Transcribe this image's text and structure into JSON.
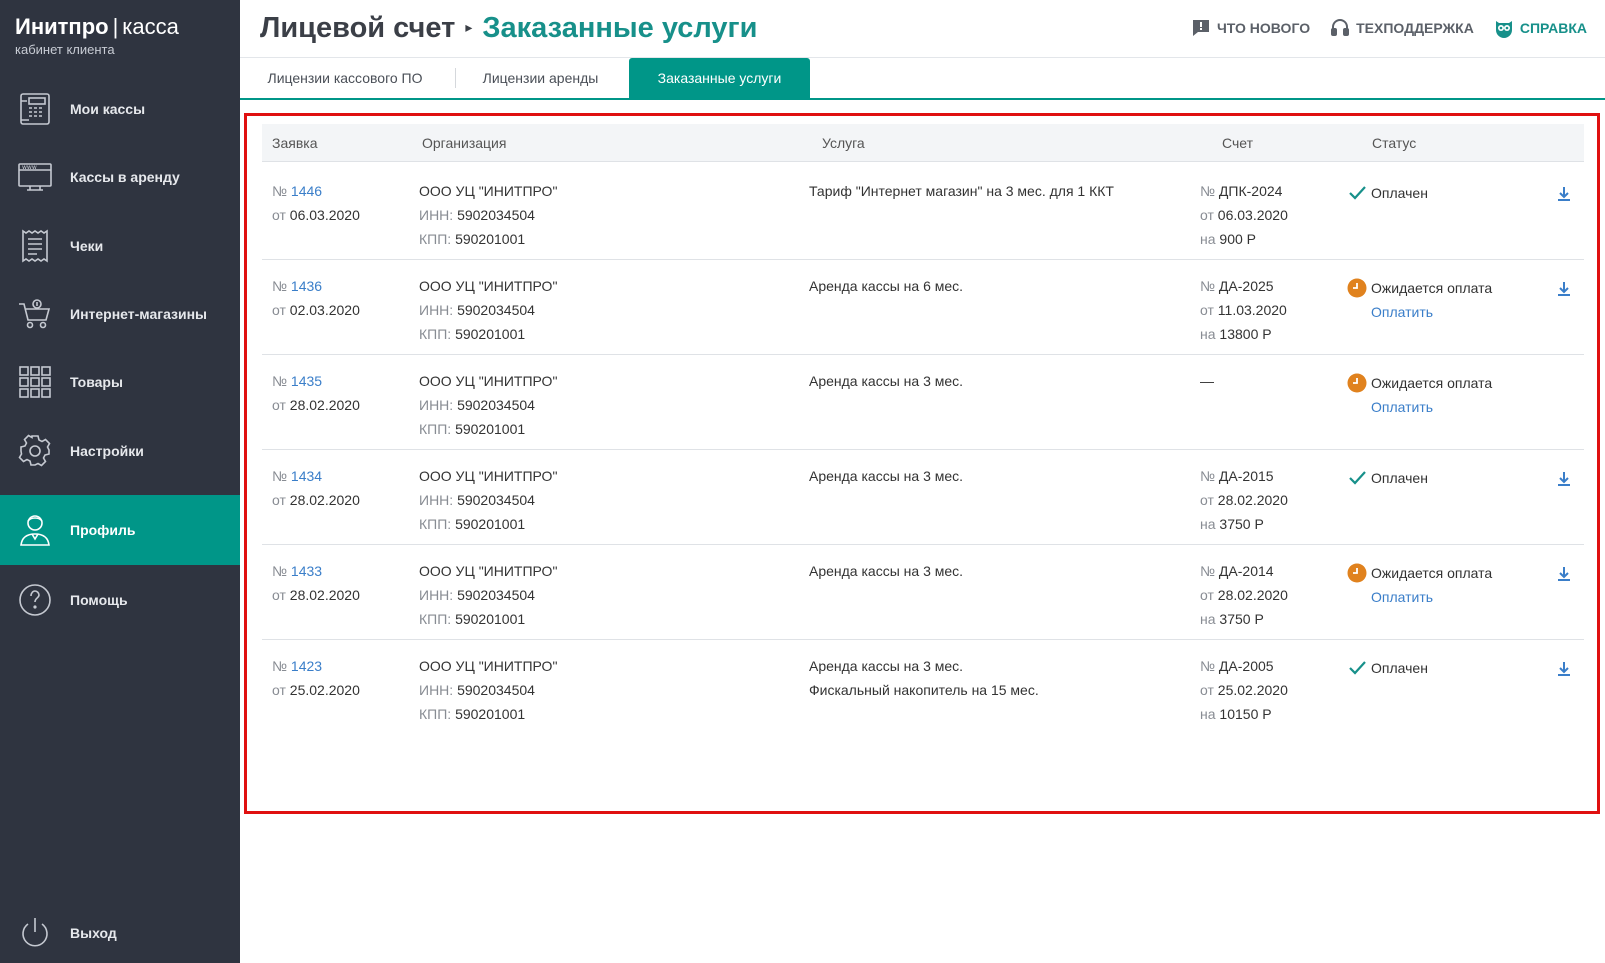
{
  "brand": {
    "name_bold": "Инитпро",
    "divider": "|",
    "name_light": "касса",
    "subtitle": "кабинет клиента"
  },
  "sidebar": {
    "items": [
      {
        "label": "Мои кассы",
        "icon": "cash-register-icon"
      },
      {
        "label": "Кассы в аренду",
        "icon": "www-monitor-icon"
      },
      {
        "label": "Чеки",
        "icon": "receipt-icon"
      },
      {
        "label": "Интернет-магазины",
        "icon": "cart-icon"
      },
      {
        "label": "Товары",
        "icon": "grid-icon"
      },
      {
        "label": "Настройки",
        "icon": "gear-icon"
      },
      {
        "label": "Профиль",
        "icon": "user-icon",
        "active": true
      },
      {
        "label": "Помощь",
        "icon": "question-icon"
      }
    ],
    "logout": {
      "label": "Выход",
      "icon": "power-icon"
    }
  },
  "header": {
    "crumb_parent": "Лицевой счет",
    "crumb_arrow": "▸",
    "crumb_current": "Заказанные услуги",
    "links": {
      "news": "ЧТО НОВОГО",
      "support": "ТЕХПОДДЕРЖКА",
      "help": "СПРАВКА"
    }
  },
  "tabs": [
    {
      "label": "Лицензии кассового ПО"
    },
    {
      "label": "Лицензии аренды"
    },
    {
      "label": "Заказанные услуги",
      "active": true
    }
  ],
  "table": {
    "headers": {
      "order": "Заявка",
      "org": "Организация",
      "service": "Услуга",
      "invoice": "Счет",
      "status": "Статус"
    },
    "labels": {
      "no": "№",
      "from": "от",
      "inn": "ИНН:",
      "kpp": "КПП:",
      "sum": "на",
      "pay": "Оплатить"
    },
    "rows": [
      {
        "num": "1446",
        "date": "06.03.2020",
        "org": "ООО УЦ \"ИНИТПРО\"",
        "inn": "5902034504",
        "kpp": "590201001",
        "service1": "Тариф \"Интернет магазин\" на 3 мес. для 1 ККТ",
        "service2": "",
        "inv_num": "ДПК-2024",
        "inv_date": "06.03.2020",
        "inv_sum": "900 Р",
        "status": "Оплачен",
        "paid": true
      },
      {
        "num": "1436",
        "date": "02.03.2020",
        "org": "ООО УЦ \"ИНИТПРО\"",
        "inn": "5902034504",
        "kpp": "590201001",
        "service1": "Аренда кассы на 6 мес.",
        "service2": "",
        "inv_num": "ДА-2025",
        "inv_date": "11.03.2020",
        "inv_sum": "13800 Р",
        "status": "Ожидается оплата",
        "paid": false
      },
      {
        "num": "1435",
        "date": "28.02.2020",
        "org": "ООО УЦ \"ИНИТПРО\"",
        "inn": "5902034504",
        "kpp": "590201001",
        "service1": "Аренда кассы на 3 мес.",
        "service2": "",
        "inv_none": "—",
        "status": "Ожидается оплата",
        "paid": false
      },
      {
        "num": "1434",
        "date": "28.02.2020",
        "org": "ООО УЦ \"ИНИТПРО\"",
        "inn": "5902034504",
        "kpp": "590201001",
        "service1": "Аренда кассы на 3 мес.",
        "service2": "",
        "inv_num": "ДА-2015",
        "inv_date": "28.02.2020",
        "inv_sum": "3750 Р",
        "status": "Оплачен",
        "paid": true
      },
      {
        "num": "1433",
        "date": "28.02.2020",
        "org": "ООО УЦ \"ИНИТПРО\"",
        "inn": "5902034504",
        "kpp": "590201001",
        "service1": "Аренда кассы на 3 мес.",
        "service2": "",
        "inv_num": "ДА-2014",
        "inv_date": "28.02.2020",
        "inv_sum": "3750 Р",
        "status": "Ожидается оплата",
        "paid": false
      },
      {
        "num": "1423",
        "date": "25.02.2020",
        "org": "ООО УЦ \"ИНИТПРО\"",
        "inn": "5902034504",
        "kpp": "590201001",
        "service1": "Аренда кассы на 3 мес.",
        "service2": "Фискальный накопитель на 15 мес.",
        "inv_num": "ДА-2005",
        "inv_date": "25.02.2020",
        "inv_sum": "10150 Р",
        "status": "Оплачен",
        "paid": true
      }
    ]
  },
  "colors": {
    "sidebar_bg": "#2f3440",
    "accent": "#009688",
    "link": "#3a7ec9",
    "highlight_border": "#e01010",
    "pending": "#e0821e"
  }
}
